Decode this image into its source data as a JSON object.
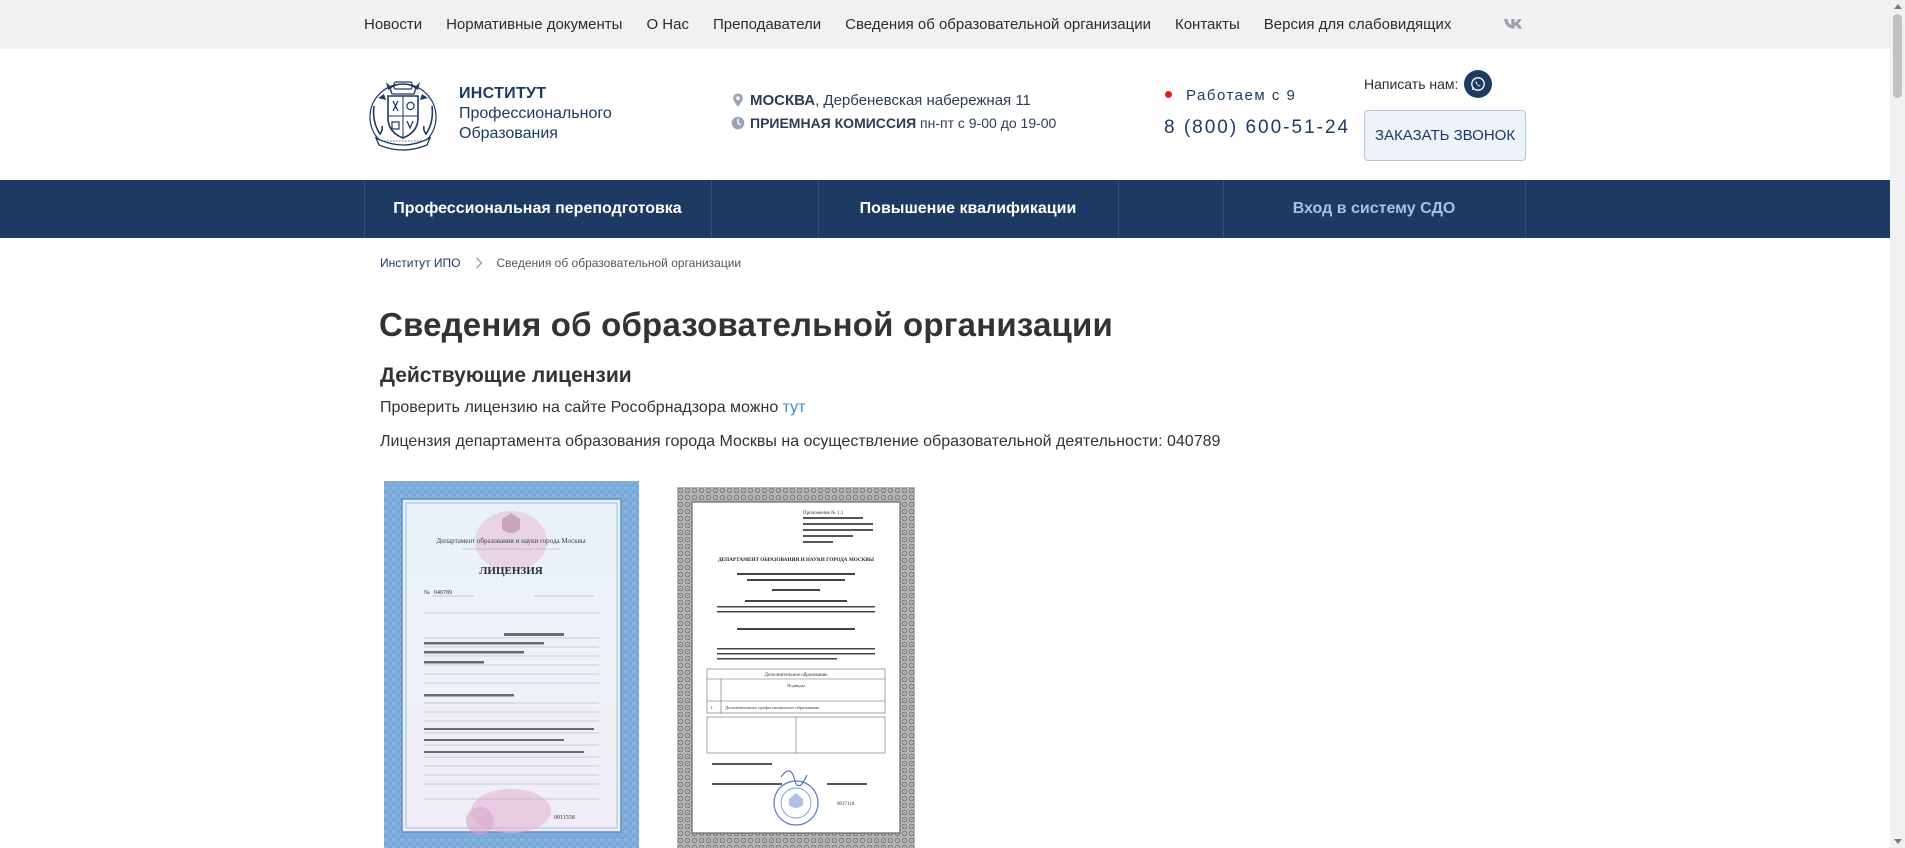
{
  "topnav": {
    "items": [
      "Новости",
      "Нормативные документы",
      "О Нас",
      "Преподаватели",
      "Сведения об образовательной организации",
      "Контакты",
      "Версия для слабовидящих"
    ],
    "social_icon": "vk-icon"
  },
  "header": {
    "logo": {
      "line1": "ИНСТИТУТ",
      "line2": "Профессионального",
      "line3": "Образования"
    },
    "address": {
      "city": "Москва",
      "street": ", Дербеневская набережная 11",
      "icon": "location-pin-icon"
    },
    "hours": {
      "label": "Приемная комиссия",
      "value": " пн-пт с 9-00 до 19-00",
      "icon": "clock-icon"
    },
    "work": "Работаем с 9",
    "phone": "8 (800) 600-51-24",
    "write_label": "Написать нам:",
    "callback_label": "Заказать звонок",
    "colors": {
      "brand": "#1d3a63",
      "status_dot": "#e02020",
      "link": "#3b8fd1"
    }
  },
  "mainnav": {
    "items": [
      "Профессиональная переподготовка",
      "Повышение квалификации",
      "Вход в систему СДО"
    ]
  },
  "breadcrumb": {
    "home": "Институт ИПО",
    "current": "Сведения об образовательной организации"
  },
  "content": {
    "title": "Сведения об образовательной организации",
    "section_title": "Действующие лицензии",
    "check_text": "Проверить лицензию на сайте Рособрнадзора можно ",
    "check_link": "тут",
    "license_text": "Лицензия департамента образования города Москвы на осуществление образовательной деятельности: 040789",
    "doc1": {
      "department": "Департамент образования и науки города Москвы",
      "title": "ЛИЦЕНЗИЯ",
      "number_label": "№",
      "number": "040789",
      "series_number": "0011558"
    },
    "doc2": {
      "appendix": "Приложение № 1.1",
      "department": "ДЕПАРТАМЕНТ ОБРАЗОВАНИЯ И НАУКИ ГОРОДА МОСКВЫ",
      "section": "Дополнительное образование",
      "subsection": "Подвиды",
      "row_num": "1.",
      "row_text": "Дополнительное профессиональное образование",
      "series_number": "0017118"
    }
  }
}
